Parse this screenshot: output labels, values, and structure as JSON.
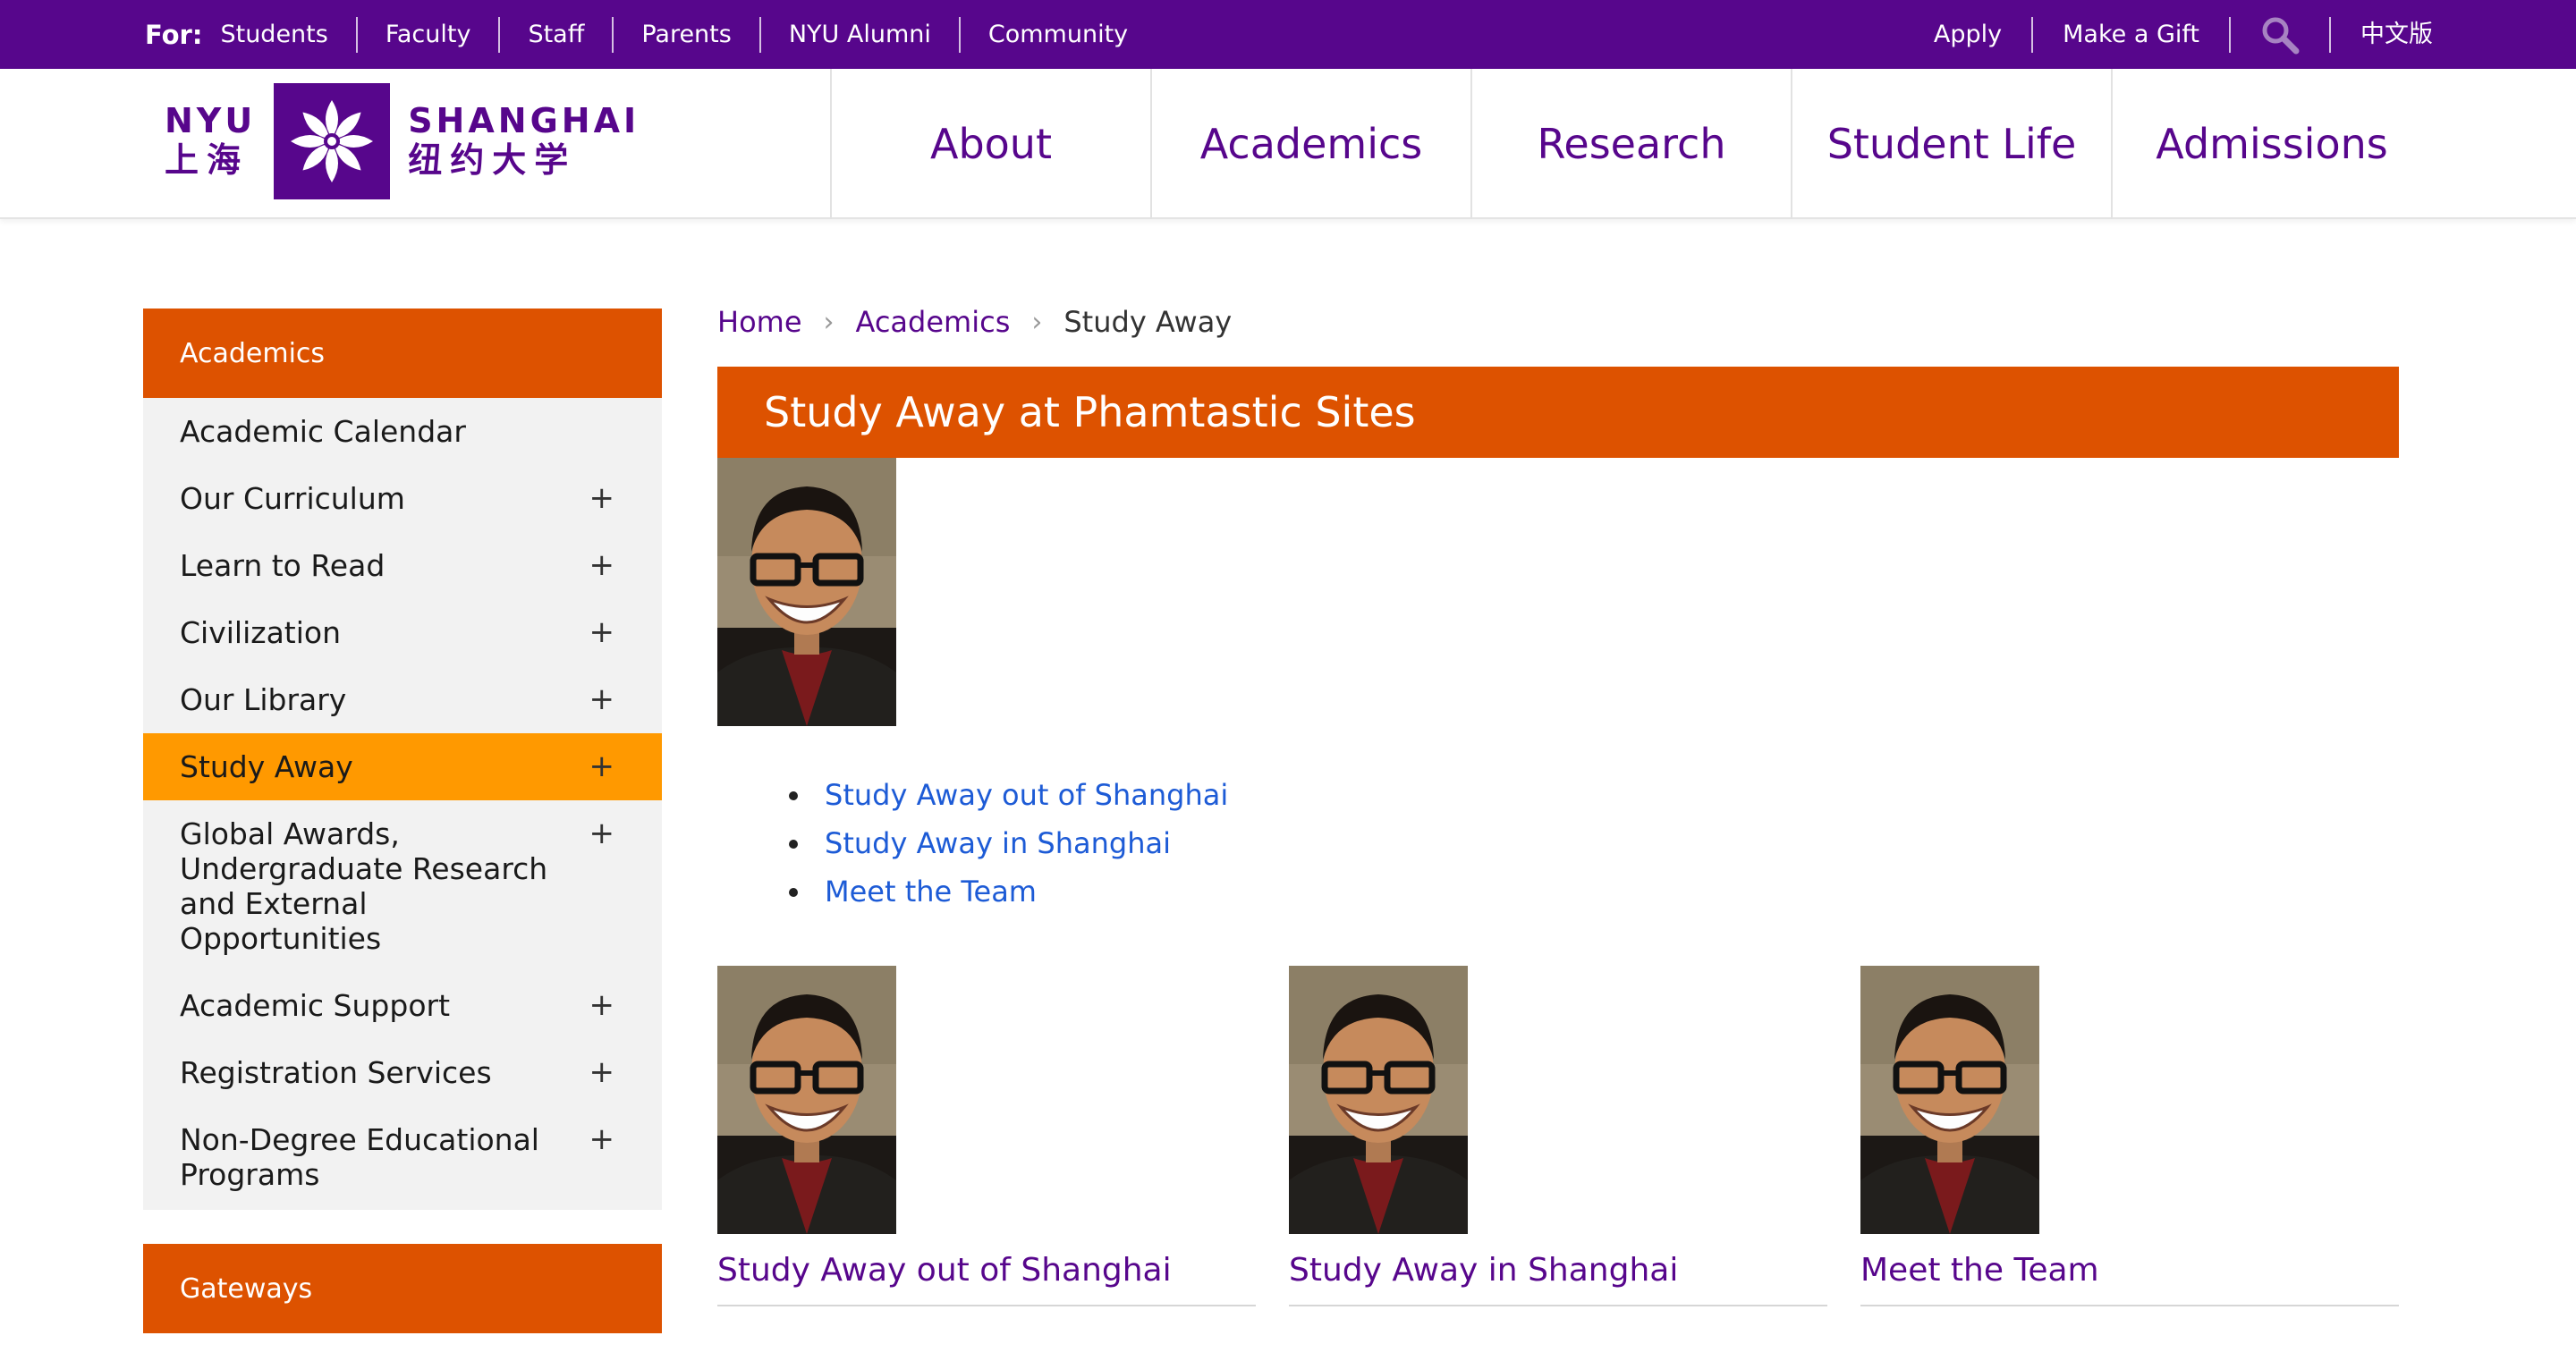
{
  "colors": {
    "brand_purple": "#57068c",
    "orange": "#dd5200",
    "active_orange": "#ff9900",
    "link_blue": "#1d5bd6"
  },
  "utility": {
    "for_label": "For:",
    "left_links": [
      "Students",
      "Faculty",
      "Staff",
      "Parents",
      "NYU Alumni",
      "Community"
    ],
    "apply": "Apply",
    "gift": "Make a Gift",
    "search_icon": "search-icon",
    "lang": "中文版"
  },
  "logo": {
    "en_left": "NYU",
    "zh_left": "上海",
    "en_right": "SHANGHAI",
    "zh_right": "纽约大学"
  },
  "nav": [
    "About",
    "Academics",
    "Research",
    "Student Life",
    "Admissions"
  ],
  "sidebar": {
    "heading": "Academics",
    "items": [
      {
        "label": "Academic Calendar",
        "plus": ""
      },
      {
        "label": "Our Curriculum",
        "plus": "+"
      },
      {
        "label": "Learn to Read",
        "plus": "+"
      },
      {
        "label": "Civilization",
        "plus": "+"
      },
      {
        "label": "Our Library",
        "plus": "+"
      },
      {
        "label": "Study Away",
        "plus": "+"
      },
      {
        "label": "Global Awards, Undergraduate Research and External Opportunities",
        "plus": "+"
      },
      {
        "label": "Academic Support",
        "plus": "+"
      },
      {
        "label": "Registration Services",
        "plus": "+"
      },
      {
        "label": "Non-Degree Educational Programs",
        "plus": "+"
      }
    ],
    "gateways": "Gateways"
  },
  "breadcrumb": {
    "home": "Home",
    "section": "Academics",
    "current": "Study Away",
    "sep": "›"
  },
  "page_title": "Study Away at Phamtastic Sites",
  "links": [
    "Study Away out of Shanghai",
    "Study Away in Shanghai",
    "Meet the Team"
  ],
  "cards": [
    {
      "title": "Study Away out of Shanghai"
    },
    {
      "title": "Study Away in Shanghai"
    },
    {
      "title": "Meet the Team"
    }
  ]
}
